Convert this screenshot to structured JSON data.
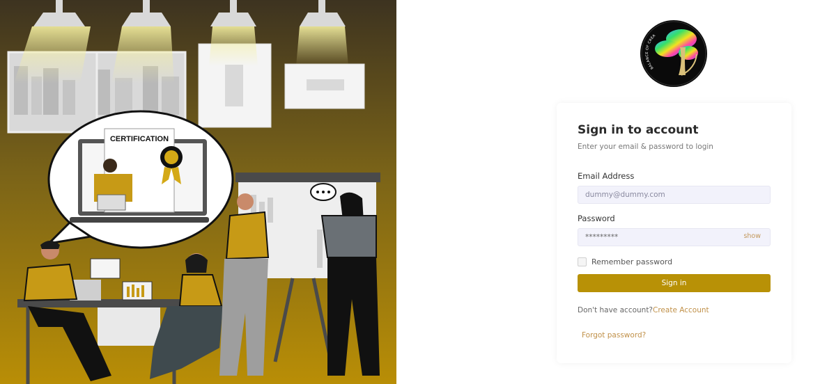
{
  "logo": {
    "arc_text": "BALANCE OF CREATION"
  },
  "illustration": {
    "certificate_title": "CERTIFICATION"
  },
  "login": {
    "title": "Sign in to account",
    "subtitle": "Enter your email & password to login",
    "email_label": "Email Address",
    "email_placeholder": "dummy@dummy.com",
    "password_label": "Password",
    "password_value": "*********",
    "show_label": "show",
    "remember_label": "Remember password",
    "signin_label": "Sign in",
    "no_account_text": "Don't have account?",
    "create_account_label": "Create Account",
    "forgot_label": "Forgot password?"
  },
  "colors": {
    "accent": "#b89106",
    "link": "#c09048"
  }
}
